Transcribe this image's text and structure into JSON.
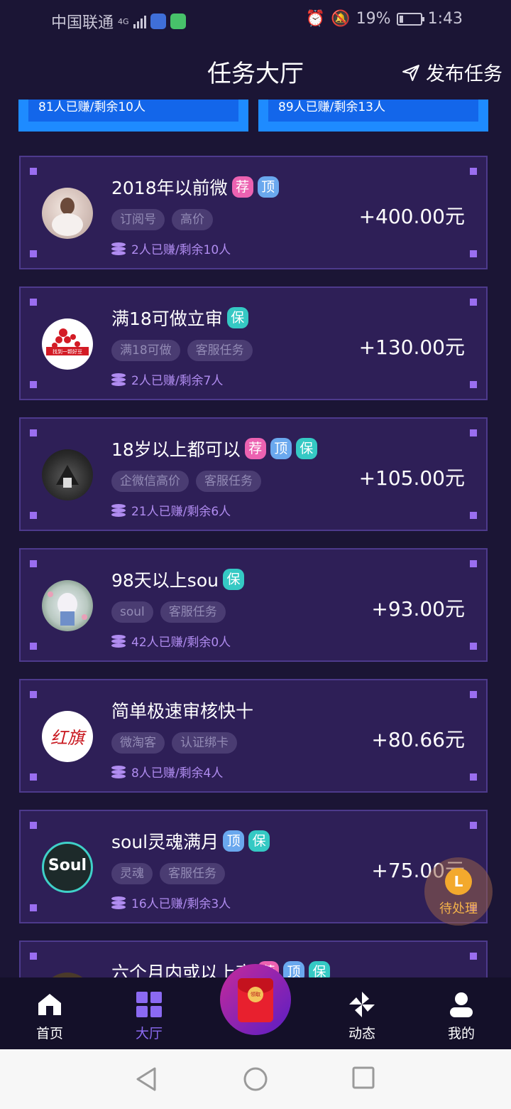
{
  "status_bar": {
    "carrier": "中国联通",
    "network": "4G",
    "battery": "19%",
    "battery_level": 0.19,
    "time": "1:43"
  },
  "header": {
    "title": "任务大厅",
    "publish_label": "发布任务"
  },
  "top_strips": [
    {
      "text": "81人已赚/剩余10人"
    },
    {
      "text": "89人已赚/剩余13人"
    }
  ],
  "tasks": [
    {
      "name": "2018年以前微",
      "badges": [
        "荐",
        "顶"
      ],
      "tags": [
        "订阅号",
        "高价"
      ],
      "earned": "2人已赚/剩余10人",
      "price": "+400.00元"
    },
    {
      "name": "满18可做立审",
      "badges": [
        "保"
      ],
      "tags": [
        "满18可做",
        "客服任务"
      ],
      "earned": "2人已赚/剩余7人",
      "price": "+130.00元",
      "avatar_text": "找到一颗好豆"
    },
    {
      "name": "18岁以上都可以",
      "badges": [
        "荐",
        "顶",
        "保"
      ],
      "tags": [
        "企微信高价",
        "客服任务"
      ],
      "earned": "21人已赚/剩余6人",
      "price": "+105.00元"
    },
    {
      "name": "98天以上sou",
      "badges": [
        "保"
      ],
      "tags": [
        "soul",
        "客服任务"
      ],
      "earned": "42人已赚/剩余0人",
      "price": "+93.00元"
    },
    {
      "name": "简单极速审核快十",
      "badges": [],
      "tags": [
        "微淘客",
        "认证绑卡"
      ],
      "earned": "8人已赚/剩余4人",
      "price": "+80.66元",
      "avatar_text": "红旗"
    },
    {
      "name": "soul灵魂满月",
      "badges": [
        "顶",
        "保"
      ],
      "tags": [
        "灵魂",
        "客服任务"
      ],
      "earned": "16人已赚/剩余3人",
      "price": "+75.00元",
      "avatar_text": "Soul"
    },
    {
      "name": "六个月内或以上高",
      "badges": [
        "荐",
        "顶",
        "保"
      ],
      "tags": [],
      "earned": "",
      "price": ""
    }
  ],
  "floating": {
    "icon_letter": "L",
    "label": "待处理"
  },
  "tabbar": {
    "home": "首页",
    "hall": "大厅",
    "center_text": "领取",
    "dynamic": "动态",
    "mine": "我的"
  },
  "colors": {
    "background": "#1b1535",
    "card": "#2e1f57",
    "accent": "#8b6af2",
    "strip_blue": "#1e8bff",
    "badge_jian": "#ec62b1",
    "badge_ding": "#6aa8ee",
    "badge_bao": "#35c9c4"
  }
}
